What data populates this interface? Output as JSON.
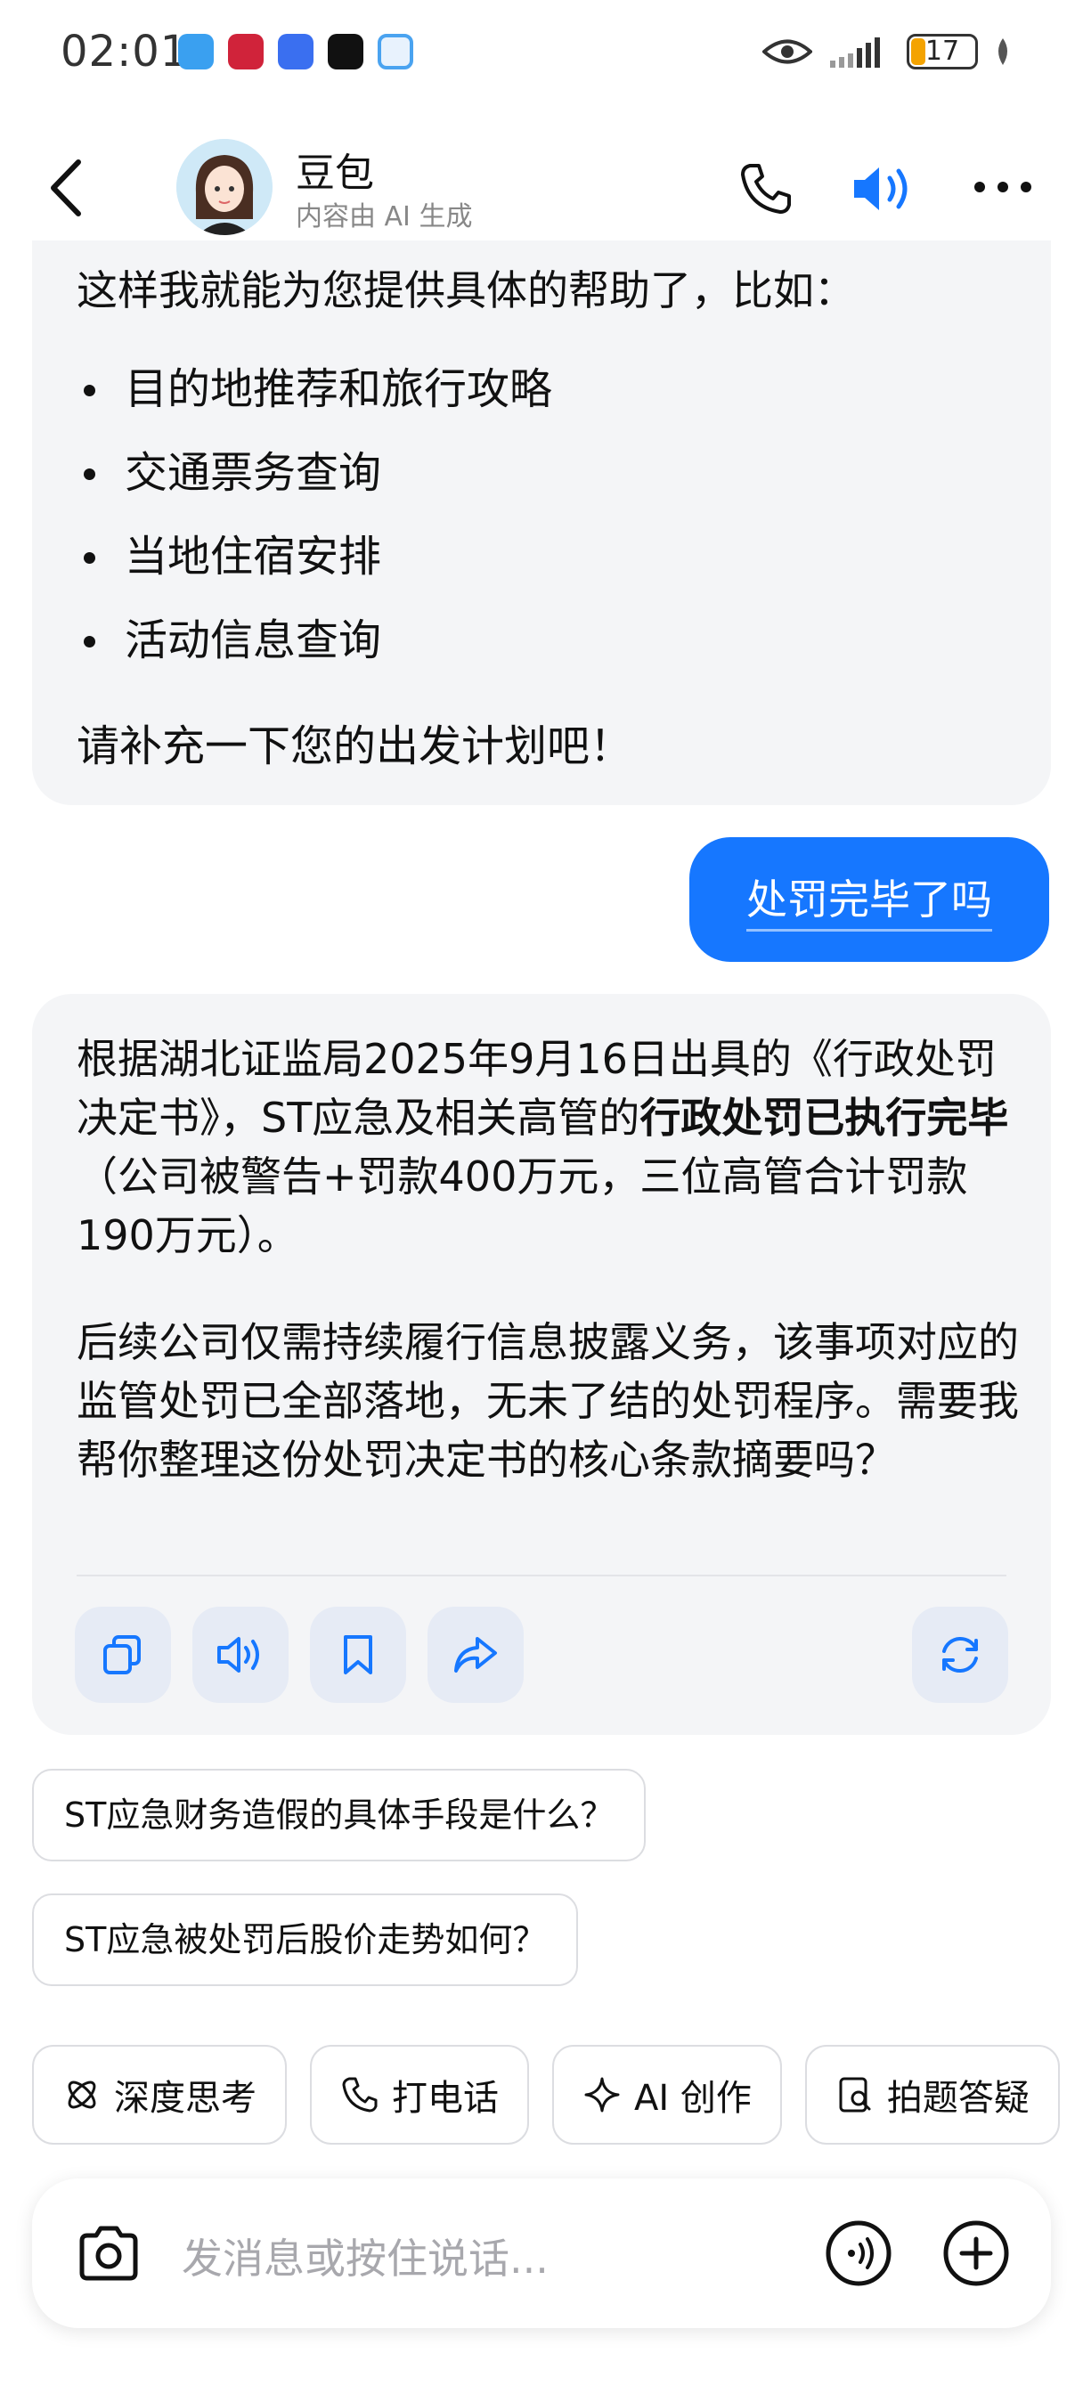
{
  "status": {
    "time": "02:01",
    "battery": "17"
  },
  "header": {
    "title": "豆包",
    "subtitle": "内容由 AI 生成"
  },
  "message1": {
    "intro": "这样我就能为您提供具体的帮助了，比如：",
    "items": [
      "目的地推荐和旅行攻略",
      "交通票务查询",
      "当地住宿安排",
      "活动信息查询"
    ],
    "ask": "请补充一下您的出发计划吧！"
  },
  "user_message": "处罚完毕了吗",
  "message2": {
    "p1_pre": "根据湖北证监局2025年9月16日出具的《行政处罚决定书》，ST应急及相关高管的",
    "p1_bold": "行政处罚已执行完毕",
    "p1_post": "（公司被警告+罚款400万元，三位高管合计罚款190万元）。",
    "p2": "后续公司仅需持续履行信息披露义务，该事项对应的监管处罚已全部落地，无未了结的处罚程序。需要我帮你整理这份处罚决定书的核心条款摘要吗？"
  },
  "suggestions": [
    "ST应急财务造假的具体手段是什么？",
    "ST应急被处罚后股价走势如何？"
  ],
  "chips": [
    {
      "label": "深度思考",
      "icon": "atom-icon"
    },
    {
      "label": "打电话",
      "icon": "phone-icon"
    },
    {
      "label": "AI 创作",
      "icon": "sparkle-icon"
    },
    {
      "label": "拍题答疑",
      "icon": "question-scan-icon"
    }
  ],
  "input": {
    "placeholder": "发消息或按住说话..."
  },
  "colors": {
    "accent": "#1677ff",
    "bubble": "#f4f5f7"
  }
}
